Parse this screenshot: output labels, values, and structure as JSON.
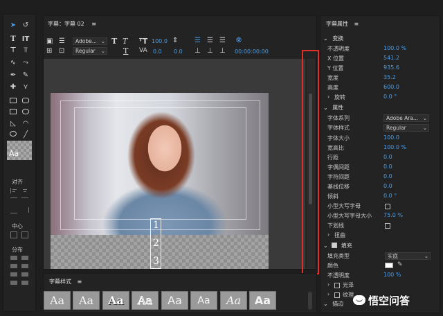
{
  "tools_panel": {
    "swatch_label": "Aa",
    "align_label": "对齐",
    "center_label": "中心",
    "distribute_label": "分布"
  },
  "title_panel": {
    "header": "字幕：字幕 02",
    "menu_icon": "hamburger-icon",
    "font_family": "Adobe...",
    "font_style": "Regular",
    "font_size": "100.0",
    "kerning": "0.0",
    "leading": "0.0",
    "timecode": "00:00:00:00",
    "safe_numbers": [
      "1",
      "2",
      "3"
    ]
  },
  "styles_panel": {
    "header": "字幕样式",
    "tiles": [
      "Aa",
      "Aa",
      "Aa",
      "Aa",
      "Aa",
      "Aa",
      "Aa",
      "Aa"
    ]
  },
  "props_panel": {
    "header": "字幕属性",
    "transform": {
      "title": "变换",
      "rows": [
        {
          "label": "不透明度",
          "value": "100.0 %"
        },
        {
          "label": "X 位置",
          "value": "541.2"
        },
        {
          "label": "Y 位置",
          "value": "935.6"
        },
        {
          "label": "宽度",
          "value": "35.2"
        },
        {
          "label": "高度",
          "value": "600.0"
        },
        {
          "label": "旋转",
          "value": "0.0 °"
        }
      ]
    },
    "properties": {
      "title": "属性",
      "rows": [
        {
          "label": "字体系列",
          "value": "Adobe Ara..."
        },
        {
          "label": "字体样式",
          "value": "Regular"
        },
        {
          "label": "字体大小",
          "value": "100.0"
        },
        {
          "label": "宽高比",
          "value": "100.0 %"
        },
        {
          "label": "行距",
          "value": "0.0"
        },
        {
          "label": "字偶间距",
          "value": "0.0"
        },
        {
          "label": "字符间距",
          "value": "0.0"
        },
        {
          "label": "基线位移",
          "value": "0.0"
        },
        {
          "label": "倾斜",
          "value": "0.0 °"
        },
        {
          "label": "小型大写字母",
          "value": ""
        },
        {
          "label": "小型大写字母大小",
          "value": "75.0 %"
        },
        {
          "label": "下划线",
          "value": ""
        },
        {
          "label": "扭曲",
          "value": ""
        }
      ]
    },
    "fill": {
      "title": "填充",
      "rows": [
        {
          "label": "填充类型",
          "value": "实底"
        },
        {
          "label": "颜色",
          "value": ""
        },
        {
          "label": "不透明度",
          "value": "100 %"
        },
        {
          "label": "光泽",
          "value": ""
        },
        {
          "label": "纹理",
          "value": ""
        }
      ]
    },
    "stroke_title": "描边"
  },
  "watermark": "悟空问答",
  "colors": {
    "accent": "#4d9ee6",
    "highlight": "#e0302b"
  }
}
